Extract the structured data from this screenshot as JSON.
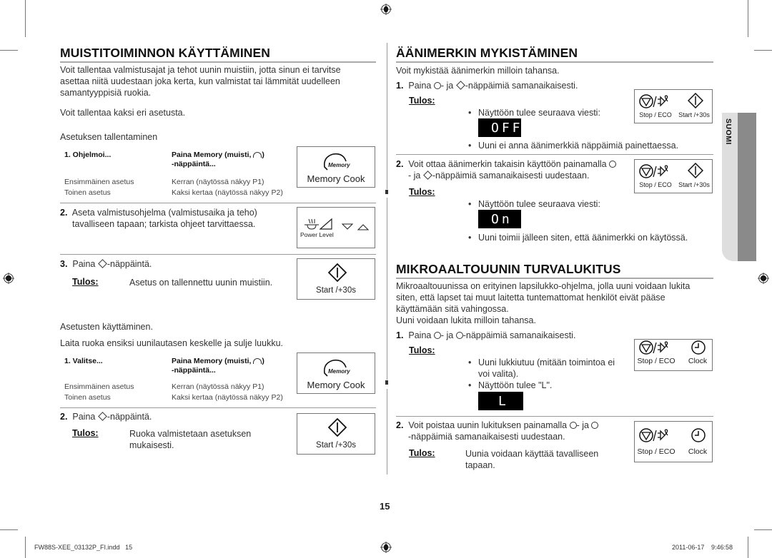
{
  "left": {
    "title": "MUISTITOIMINNON KÄYTTÄMINEN",
    "intro": [
      "Voit tallentaa valmistusajat ja tehot uunin muistiin, jotta sinun ei tarvitse",
      "asettaa niitä uudestaan joka kerta, kun valmistat tai lämmität uudelleen",
      "samantyyppisiä ruokia."
    ],
    "two_settings": "Voit tallentaa kaksi eri asetusta.",
    "save_heading": "Asetuksen tallentaminen",
    "save_table": {
      "step_label": "1. Ohjelmoi...",
      "action_line1": "Paina Memory (muisti,",
      "action_line1_end": ")",
      "action_line2": "-näppäintä...",
      "rows": [
        {
          "name": "Ensimmäinen asetus",
          "value": "Kerran (näytössä näkyy P1)"
        },
        {
          "name": "Toinen asetus",
          "value": "Kaksi kertaa (näytössä näkyy P2)"
        }
      ],
      "button": {
        "icon_text": "Memory",
        "label": "Memory Cook"
      }
    },
    "step2": {
      "num": "2.",
      "lines": [
        "Aseta valmistusohjelma (valmistusaika ja teho)",
        "tavalliseen tapaan; tarkista ohjeet tarvittaessa."
      ],
      "button": {
        "label": "Power Level"
      }
    },
    "step3": {
      "num": "3.",
      "pre": "Paina",
      "post": "-näppäintä.",
      "result_label": "Tulos:",
      "result": "Asetus on tallennettu uunin muistiin.",
      "button": {
        "label": "Start /+30s"
      }
    },
    "use_heading": "Asetusten käyttäminen.",
    "use_intro": "Laita ruoka ensiksi uunilautasen keskelle ja sulje luukku.",
    "use_table": {
      "step_label": "1. Valitse...",
      "action_line1": "Paina Memory (muisti,",
      "action_line1_end": ")",
      "action_line2": "-näppäintä...",
      "rows": [
        {
          "name": "Ensimmäinen asetus",
          "value": "Kerran (näytössä näkyy P1)"
        },
        {
          "name": "Toinen asetus",
          "value": "Kaksi kertaa (näytössä näkyy P2)"
        }
      ],
      "button": {
        "icon_text": "Memory",
        "label": "Memory Cook"
      }
    },
    "use_step2": {
      "num": "2.",
      "pre": "Paina",
      "post": "-näppäintä.",
      "result_label": "Tulos:",
      "result": [
        "Ruoka valmistetaan asetuksen",
        "mukaisesti."
      ],
      "button": {
        "label": "Start /+30s"
      }
    }
  },
  "right": {
    "mute": {
      "title": "ÄÄNIMERKIN MYKISTÄMINEN",
      "intro": "Voit mykistää äänimerkin milloin tahansa.",
      "step1": {
        "num": "1.",
        "pre": "Paina",
        "mid": "- ja",
        "post": "-näppäimiä samanaikaisesti.",
        "result_label": "Tulos:",
        "bullet1": "Näyttöön tulee seuraava viesti:",
        "lcd": "OFF",
        "bullet2": "Uuni ei anna äänimerkkiä näppäimiä painettaessa.",
        "buttons": [
          "Stop / ECO",
          "Start /+30s"
        ]
      },
      "step2": {
        "num": "2.",
        "line1": "Voit ottaa äänimerkin takaisin käyttöön painamalla",
        "line2_pre": "- ja",
        "line2_post": "-näppäimiä samanaikaisesti uudestaan.",
        "result_label": "Tulos:",
        "bullet1": "Näyttöön tulee seuraava viesti:",
        "lcd": "On",
        "bullet2": "Uuni toimii jälleen siten, että äänimerkki on käytössä.",
        "buttons": [
          "Stop / ECO",
          "Start /+30s"
        ]
      }
    },
    "lock": {
      "title": "MIKROAALTOUUNIN TURVALUKITUS",
      "intro": [
        "Mikroaaltouunissa on erityinen lapsilukko-ohjelma, jolla uuni voidaan lukita",
        "siten, että lapset tai muut laitetta tuntemattomat henkilöt eivät pääse",
        "käyttämään sitä vahingossa.",
        "Uuni voidaan lukita milloin tahansa."
      ],
      "step1": {
        "num": "1.",
        "pre": "Paina",
        "mid": "- ja",
        "post": "-näppäimiä samanaikaisesti.",
        "result_label": "Tulos:",
        "bullet1": [
          "Uuni lukkiutuu (mitään toimintoa ei",
          "voi valita)."
        ],
        "bullet2": "Näyttöön tulee \"L\".",
        "lcd": "L",
        "buttons": [
          "Stop / ECO",
          "Clock"
        ]
      },
      "step2": {
        "num": "2.",
        "line1": "Voit poistaa uunin lukituksen painamalla",
        "line1_mid": "- ja",
        "line2": "-näppäimiä samanaikaisesti uudestaan.",
        "result_label": "Tulos:",
        "result": [
          "Uunia voidaan käyttää tavalliseen",
          "tapaan."
        ],
        "buttons": [
          "Stop / ECO",
          "Clock"
        ]
      }
    }
  },
  "side_tab": "SUOMI",
  "page_number": "15",
  "footer": {
    "file": "FW88S-XEE_03132P_FI.indd   15",
    "date": "2011-06-17",
    "time": "9:46:58"
  }
}
